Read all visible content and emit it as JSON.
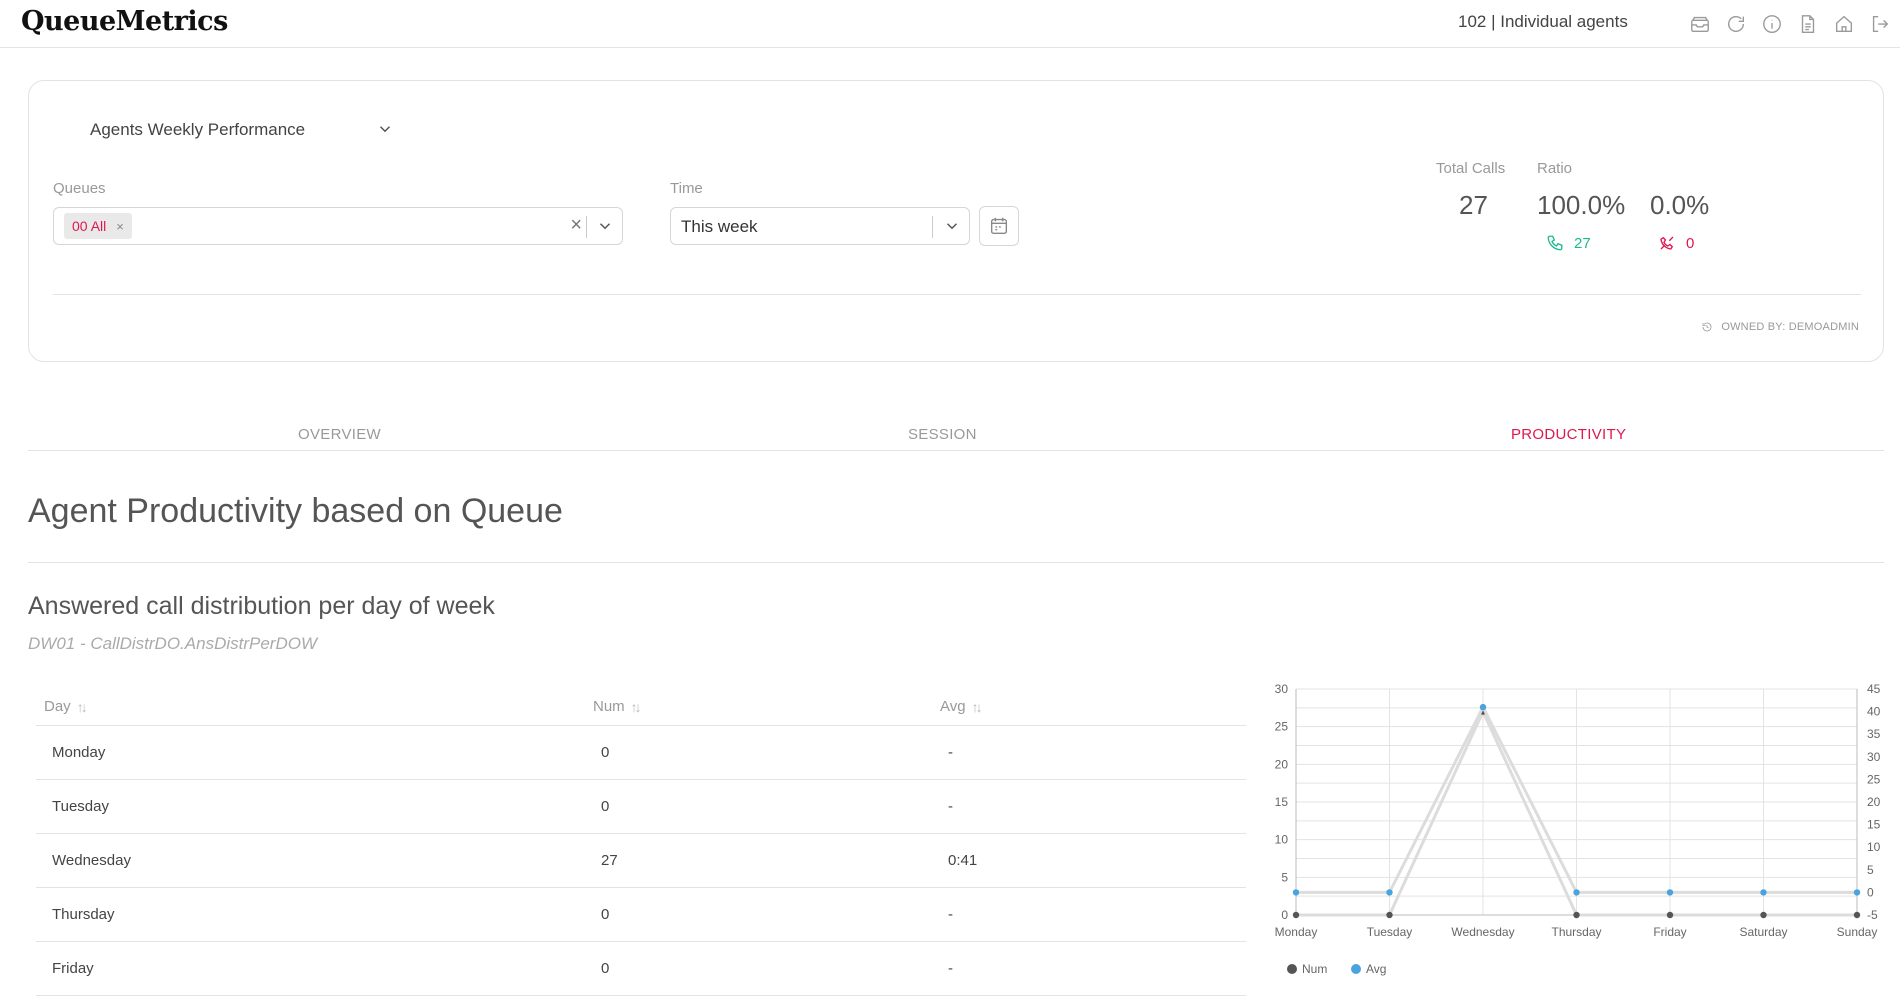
{
  "header": {
    "logo": "QueueMetrics",
    "agents_label": "102 | Individual agents",
    "icons": [
      "inbox-icon",
      "refresh-icon",
      "info-icon",
      "document-icon",
      "home-icon",
      "logout-icon"
    ]
  },
  "filters": {
    "report_name": "Agents Weekly Performance",
    "queues_label": "Queues",
    "queue_chip": "00 All",
    "time_label": "Time",
    "time_value": "This week"
  },
  "stats": {
    "total_calls_label": "Total Calls",
    "total_calls": "27",
    "ratio_label": "Ratio",
    "answered_ratio": "100.0%",
    "lost_ratio": "0.0%",
    "answered_count": "27",
    "lost_count": "0"
  },
  "owned_by": "OWNED BY: DEMOADMIN",
  "tabs": [
    {
      "label": "OVERVIEW",
      "active": false
    },
    {
      "label": "SESSION",
      "active": false
    },
    {
      "label": "PRODUCTIVITY",
      "active": true
    }
  ],
  "page_title": "Agent Productivity based on Queue",
  "section": {
    "title": "Answered call distribution per day of week",
    "code": "DW01 - CallDistrDO.AnsDistrPerDOW"
  },
  "table": {
    "headers": [
      "Day",
      "Num",
      "Avg"
    ],
    "rows": [
      [
        "Monday",
        "0",
        "-"
      ],
      [
        "Tuesday",
        "0",
        "-"
      ],
      [
        "Wednesday",
        "27",
        "0:41"
      ],
      [
        "Thursday",
        "0",
        "-"
      ],
      [
        "Friday",
        "0",
        "-"
      ]
    ]
  },
  "colors": {
    "accent": "#e0174f",
    "answered": "#1bb890",
    "num_series": "#555555",
    "avg_series": "#4aa3df"
  },
  "chart_data": {
    "type": "line",
    "categories": [
      "Monday",
      "Tuesday",
      "Wednesday",
      "Thursday",
      "Friday",
      "Saturday",
      "Sunday"
    ],
    "series": [
      {
        "name": "Num",
        "axis": "left",
        "values": [
          0,
          0,
          27,
          0,
          0,
          0,
          0
        ]
      },
      {
        "name": "Avg",
        "axis": "right",
        "values": [
          0,
          0,
          41,
          0,
          0,
          0,
          0
        ]
      }
    ],
    "y_left": {
      "min": 0,
      "max": 30,
      "ticks": [
        0,
        5,
        10,
        15,
        20,
        25,
        30
      ]
    },
    "y_right": {
      "min": -5,
      "max": 45,
      "ticks": [
        -5,
        0,
        5,
        10,
        15,
        20,
        25,
        30,
        35,
        40,
        45
      ]
    },
    "legend": "bottom-left",
    "grid": true
  }
}
